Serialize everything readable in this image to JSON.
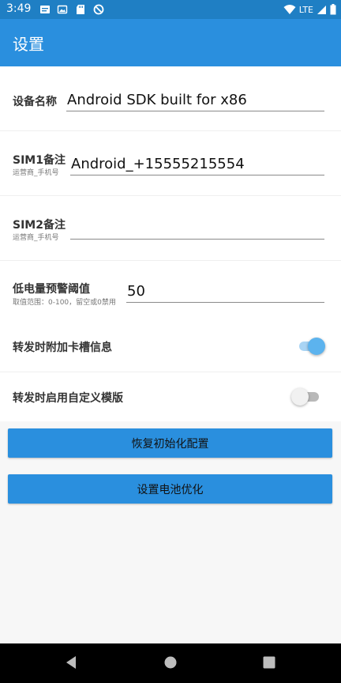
{
  "status_bar": {
    "time": "3:49",
    "network": "LTE",
    "icons": [
      "email-icon",
      "photo-icon",
      "sd-card-icon",
      "no-entry-icon",
      "wifi-icon",
      "signal-icon",
      "battery-icon"
    ]
  },
  "app_bar": {
    "title": "设置"
  },
  "settings": {
    "device_name": {
      "label": "设备名称",
      "value": "Android SDK built for x86"
    },
    "sim1": {
      "label": "SIM1备注",
      "hint": "运营商_手机号",
      "value": "Android_+15555215554"
    },
    "sim2": {
      "label": "SIM2备注",
      "hint": "运营商_手机号",
      "value": ""
    },
    "battery_threshold": {
      "label": "低电量预警阈值",
      "hint": "取值范围：0-100，留空或0禁用",
      "value": "50"
    },
    "append_slot_info": {
      "label": "转发时附加卡槽信息",
      "enabled": true
    },
    "custom_template": {
      "label": "转发时启用自定义模版",
      "enabled": false
    }
  },
  "buttons": {
    "reset": "恢复初始化配置",
    "battery_optimization": "设置电池优化"
  },
  "colors": {
    "status_bar": "#1f7fc4",
    "app_bar": "#2a8fde",
    "toggle_on_track": "#a9d4f4",
    "toggle_on_knob": "#5cb3ee",
    "toggle_off_track": "#b9b9b9",
    "toggle_off_knob": "#f1f1f1"
  },
  "nav_icons": [
    "back-icon",
    "home-icon",
    "recents-icon"
  ]
}
